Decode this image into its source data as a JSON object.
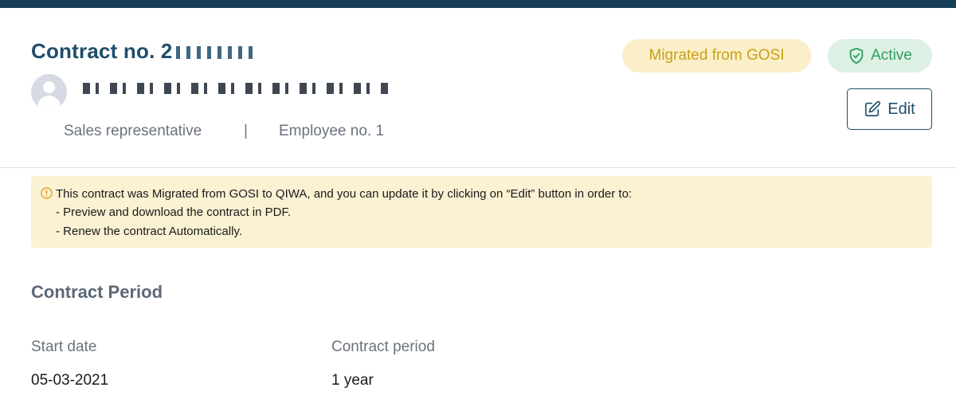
{
  "header": {
    "contract_title": "Contract no. 2",
    "name_redacted": "",
    "role": "Sales representative",
    "separator": "|",
    "employee_no": "Employee no. 1",
    "badges": {
      "migrated": "Migrated from GOSI",
      "status": "Active"
    },
    "edit_label": "Edit"
  },
  "notice": {
    "line1": "This contract was Migrated from GOSI  to QIWA, and you can update it by clicking on “Edit” button in order to:",
    "line2": "- Preview and download the  contract in PDF.",
    "line3": "- Renew the contract Automatically."
  },
  "contract_period": {
    "section_title": "Contract Period",
    "start_date_label": "Start date",
    "start_date_value": "05-03-2021",
    "period_label": "Contract period",
    "period_value": "1 year"
  },
  "colors": {
    "brand": "#1e4d6c",
    "topbar": "#163d57",
    "gosi_badge_bg": "#fbefc9",
    "gosi_badge_text": "#c9a019",
    "active_badge_bg": "#dcf1e3",
    "active_badge_text": "#2f9c61",
    "notice_bg": "#fbf1d3"
  },
  "icons": [
    "avatar-icon",
    "shield-check-icon",
    "edit-icon",
    "warning-icon"
  ]
}
